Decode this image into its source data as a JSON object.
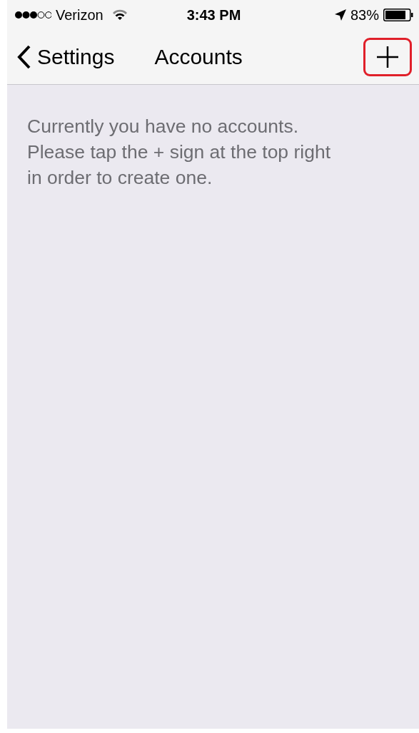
{
  "status_bar": {
    "carrier": "Verizon",
    "time": "3:43 PM",
    "battery": "83%"
  },
  "nav_bar": {
    "back": "Settings",
    "title": "Accounts",
    "add_button": {
      "highlighted": true
    }
  },
  "message": "Currently you have no accounts.\nPlease tap the + sign at the top right\nin order to create one."
}
